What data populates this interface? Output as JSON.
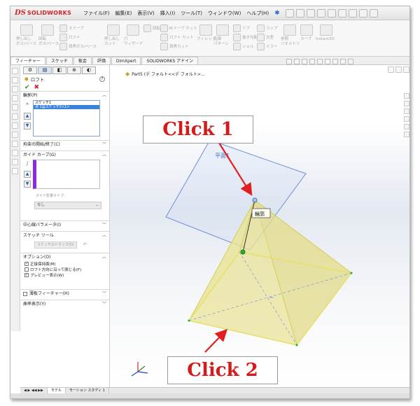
{
  "app": {
    "logo_mark": "DS",
    "logo_text": "SOLIDWORKS"
  },
  "menu": [
    "ファイル(F)",
    "編集(E)",
    "表示(V)",
    "挿入(I)",
    "ツール(T)",
    "ウィンドウ(W)",
    "ヘルプ(H)"
  ],
  "ribbon": {
    "extrude_boss": "押し出し\nボス/ベース",
    "revolve_boss": "回転\nボス/ベース",
    "sweep": "スイープ",
    "loft": "ロフト",
    "boundary_boss": "境界ボス/ベース",
    "extrude_cut": "押し出し\nカット",
    "hole_wizard": "穴\nウィザード",
    "revolve_cut": "回転カット",
    "sweep_cut": "スイープ カット",
    "loft_cut": "ロフト カット",
    "boundary_cut": "境界カット",
    "fillet": "フィレット",
    "linear_pattern": "直線\nパターン",
    "rib": "リブ",
    "draft": "抜き勾配",
    "shell": "シェル",
    "wrap": "ラップ",
    "intersect": "交差",
    "mirror": "ミラー",
    "reference_geometry": "参照\nジオメトリ",
    "curves": "カーブ",
    "instant3d": "Instant3D"
  },
  "command_tabs": [
    "フィーチャー",
    "スケッチ",
    "板金",
    "評価",
    "DimXpert",
    "SOLIDWORKS アドイン"
  ],
  "tree": {
    "part_label": "Part5 (デ フォルト<<デ フォルト>..."
  },
  "property_manager": {
    "title": "ロフト",
    "help": "?",
    "ok_symbol": "✔",
    "cancel_symbol": "✖",
    "profiles": {
      "header": "輪郭(P)",
      "items": [
        "スケッチ1",
        "点 1@スケッチ2<1>"
      ]
    },
    "start_end": {
      "header": "拘束の開始/終了(C)"
    },
    "guide_curves": {
      "header": "ガイド カーブ(G)",
      "type_label": "ガイド影響タイプ:",
      "type_value": "なし"
    },
    "centerline": {
      "header": "中心線パラメータ(I)"
    },
    "sketch_tools": {
      "header": "スケッチ ツール",
      "drag_sketch": "スケッチのドラッグ(D)"
    },
    "options": {
      "header": "オプション(O)",
      "items": [
        {
          "label": "正接保持面(M)",
          "checked": true
        },
        {
          "label": "ロフト方向に沿って閉じる(F)",
          "checked": false
        },
        {
          "label": "プレビュー表示(W)",
          "checked": true
        }
      ]
    },
    "thin_feature": {
      "header": "薄板フィーチャー(H)",
      "checked": false
    },
    "curvature_display": {
      "header": "曲率表示(Y)"
    }
  },
  "graphics": {
    "plane_label": "平面1",
    "profile_tag": "輪郭",
    "callout1": "Click 1",
    "callout2": "Click 2"
  },
  "bottom_tabs": [
    "モデル",
    "モーション スタディ 1"
  ],
  "colors": {
    "brand_red": "#d2232a",
    "callout_red": "#d51a1a",
    "plane_blue": "#6f8fd8",
    "preview_yellow": "#e8e08a",
    "guide_purple": "#8a2be2"
  }
}
